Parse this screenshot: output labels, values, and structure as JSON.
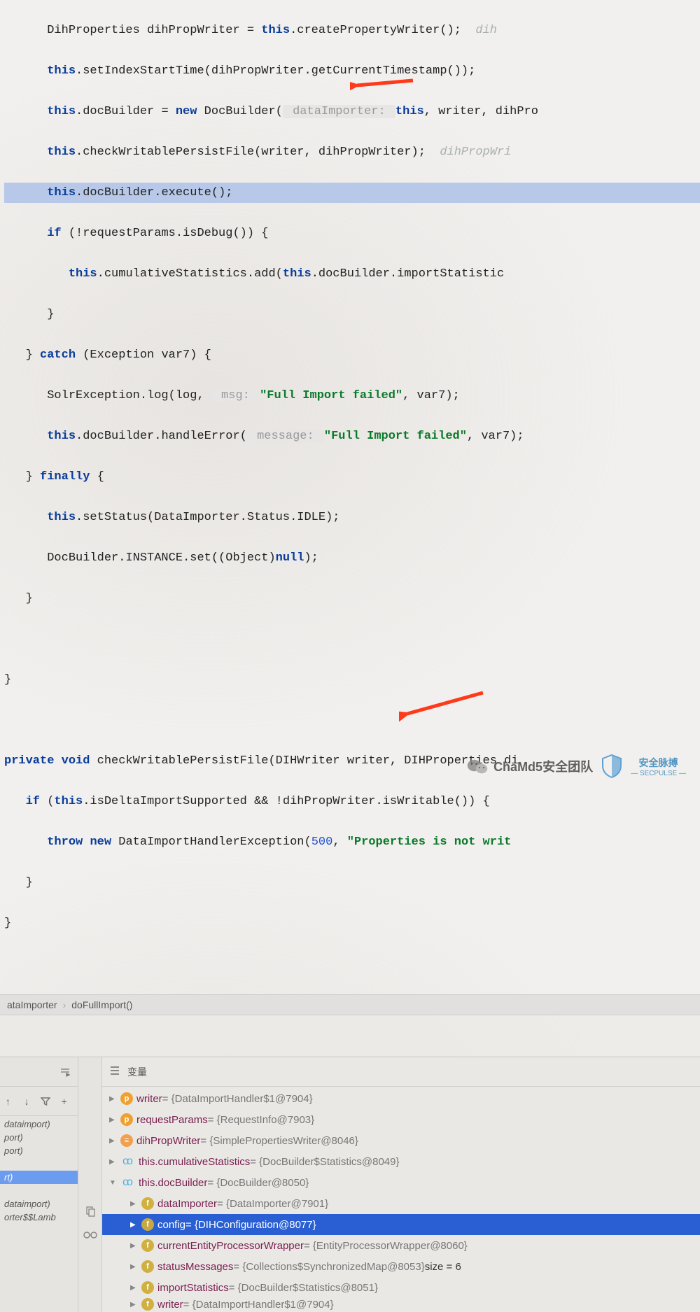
{
  "code": {
    "l0a": "      DihProperties dihPropWriter = ",
    "l0b": ".createPropertyWriter();  ",
    "l0c": "dih",
    "l1a": "      ",
    "l1b": ".setIndexStartTime(dihPropWriter.getCurrentTimestamp());",
    "l2a": "      ",
    "l2b": ".docBuilder = ",
    "l2c": " DocBuilder(",
    "l2d": " dataImporter: ",
    "l2e": ", writer, dihPro",
    "l3a": "      ",
    "l3b": ".checkWritablePersistFile(writer, dihPropWriter);  ",
    "l3c": "dihPropWri",
    "l4a": "      ",
    "l4b": ".docBuilder.execute();",
    "l5a": "      ",
    "l5b": " (!requestParams.isDebug()) {",
    "l6a": "         ",
    "l6b": ".cumulativeStatistics.add(",
    "l6c": ".docBuilder.importStatistic",
    "l7": "      }",
    "l8a": "   } ",
    "l8b": " (Exception var7) {",
    "l9a": "      SolrException.log(log, ",
    "l9b": " msg: ",
    "l9c": "\"Full Import failed\"",
    "l9d": ", var7);",
    "l10a": "      ",
    "l10b": ".docBuilder.handleError(",
    "l10c": " message: ",
    "l10d": "\"Full Import failed\"",
    "l10e": ", var7);",
    "l11a": "   } ",
    "l11b": " {",
    "l12a": "      ",
    "l12b": ".setStatus(DataImporter.Status.IDLE);",
    "l13a": "      DocBuilder.INSTANCE.set((Object)",
    "l13b": ");",
    "l14": "   }",
    "l15": "",
    "l16": "}",
    "l17": "",
    "l18a": " ",
    "l18b": " checkWritablePersistFile(DIHWriter writer, DIHProperties di",
    "l19a": "   ",
    "l19b": " (",
    "l19c": ".isDeltaImportSupported && !dihPropWriter.isWritable()) {",
    "l20a": "      ",
    "l20b": " DataImportHandlerException(",
    "l20c": "500",
    "l20d": ", ",
    "l20e": "\"Properties is not writ",
    "l21": "   }",
    "l22": "}"
  },
  "kw": {
    "this": "this",
    "new": "new",
    "if": "if",
    "catch": "catch",
    "finally": "finally",
    "null": "null",
    "private": "private",
    "void": "void",
    "throw": "throw"
  },
  "breadcrumb": {
    "a": "ataImporter",
    "b": "doFullImport()"
  },
  "frames": {
    "f1": "dataimport)",
    "f2": "port)",
    "f3": "port)",
    "f4": "rt)",
    "f5": "dataimport)",
    "f6": "orter$$Lamb"
  },
  "vars": {
    "header": "变量",
    "writer": {
      "name": "writer",
      "val": " = {DataImportHandler$1@7904}"
    },
    "requestParams": {
      "name": "requestParams",
      "val": " = {RequestInfo@7903}"
    },
    "dihPropWriter": {
      "name": "dihPropWriter",
      "val": " = {SimplePropertiesWriter@8046}"
    },
    "cumulativeStatistics": {
      "name": "this.cumulativeStatistics",
      "val": " = {DocBuilder$Statistics@8049}"
    },
    "docBuilder": {
      "name": "this.docBuilder",
      "val": " = {DocBuilder@8050}"
    },
    "dataImporter": {
      "name": "dataImporter",
      "val": " = {DataImporter@7901}"
    },
    "config": {
      "name": "config",
      "val": " = {DIHConfiguration@8077}"
    },
    "currentEntityProcessorWrapper": {
      "name": "currentEntityProcessorWrapper",
      "val": " = {EntityProcessorWrapper@8060}"
    },
    "statusMessages": {
      "name": "statusMessages",
      "val": " = {Collections$SynchronizedMap@8053}",
      "size": "  size = 6"
    },
    "importStatistics": {
      "name": "importStatistics",
      "val": " = {DocBuilder$Statistics@8051}"
    },
    "writer2": {
      "name": "writer",
      "val": " = {DataImportHandler$1@7904}"
    }
  },
  "watermark": {
    "text": "ChaMd5安全团队",
    "brand_top": "安全脉搏",
    "brand_bottom": "— SECPULSE —"
  }
}
